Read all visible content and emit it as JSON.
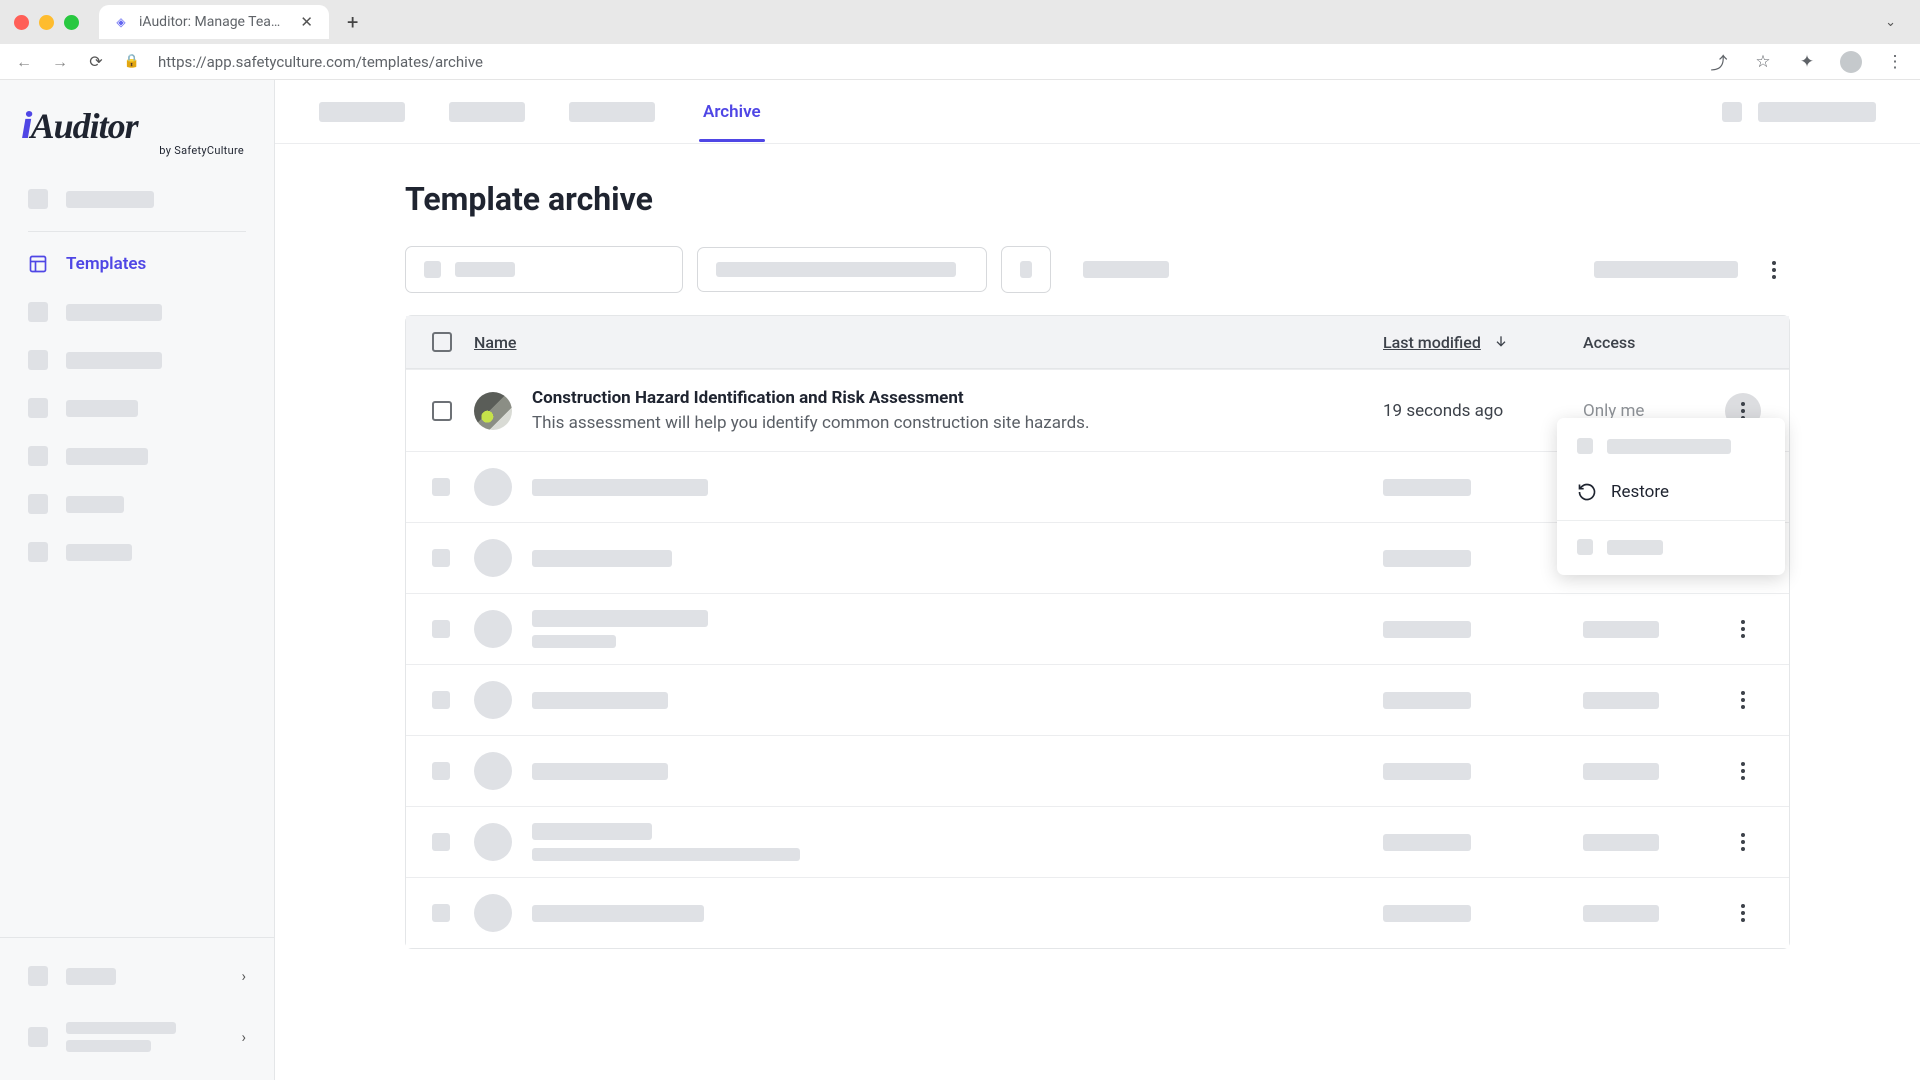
{
  "browser": {
    "tab_title": "iAuditor: Manage Teams and In",
    "url": "https://app.safetyculture.com/templates/archive"
  },
  "brand": {
    "name": "iAuditor",
    "by": "by SafetyCulture"
  },
  "sidebar": {
    "templates_label": "Templates"
  },
  "tabs": {
    "archive": "Archive"
  },
  "page": {
    "title": "Template archive"
  },
  "table": {
    "headers": {
      "name": "Name",
      "last_modified": "Last modified",
      "access": "Access"
    },
    "rows": [
      {
        "title": "Construction Hazard Identification and Risk Assessment",
        "subtitle": "This assessment will help you identify common construction site hazards.",
        "modified": "19 seconds ago",
        "access": "Only me"
      }
    ]
  },
  "menu": {
    "restore": "Restore"
  }
}
